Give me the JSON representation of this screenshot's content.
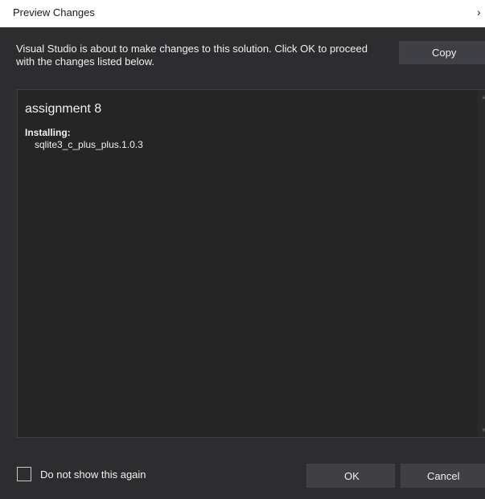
{
  "window": {
    "title": "Preview Changes",
    "close_glyph": "›",
    "colors": {
      "background": "#2d2d30",
      "panel": "#252526",
      "button": "#3f3f46",
      "text": "#f1f1f1",
      "titlebar": "#ffffff"
    }
  },
  "header": {
    "description": "Visual Studio is about to make changes to this solution. Click OK to proceed with the changes listed below.",
    "copy_label": "Copy"
  },
  "changes": {
    "project_name": "assignment 8",
    "section_label": "Installing:",
    "packages": [
      "sqlite3_c_plus_plus.1.0.3"
    ]
  },
  "footer": {
    "checkbox_label": "Do not show this again",
    "checkbox_checked": false,
    "ok_label": "OK",
    "cancel_label": "Cancel"
  },
  "icons": {
    "close": "close-icon",
    "scroll_up": "scroll-up-arrow-icon",
    "scroll_down": "scroll-down-arrow-icon"
  }
}
